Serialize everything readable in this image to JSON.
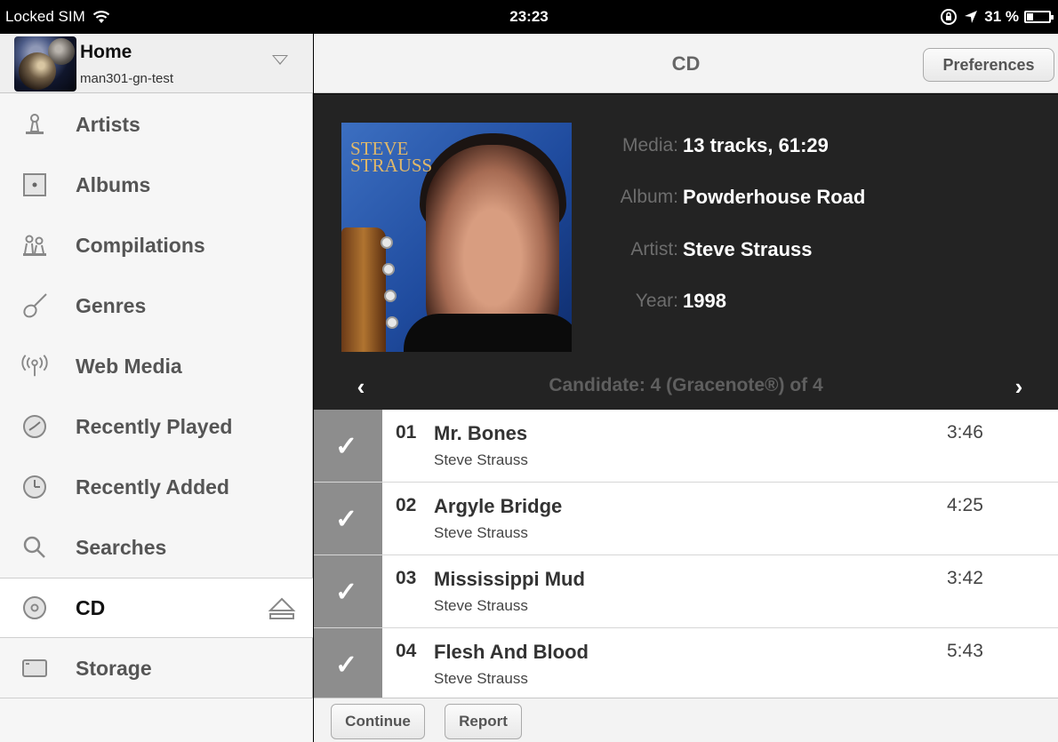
{
  "status_bar": {
    "carrier": "Locked SIM",
    "time": "23:23",
    "battery_percent": "31 %",
    "battery_level": 0.31,
    "icons": [
      "wifi-icon",
      "orientation-lock-icon",
      "location-icon",
      "battery-icon"
    ]
  },
  "sidebar": {
    "header": {
      "title": "Home",
      "subtitle": "man301-gn-test"
    },
    "items": [
      {
        "label": "Artists",
        "icon": "artist-icon"
      },
      {
        "label": "Albums",
        "icon": "album-icon"
      },
      {
        "label": "Compilations",
        "icon": "compilations-icon"
      },
      {
        "label": "Genres",
        "icon": "guitar-icon"
      },
      {
        "label": "Web Media",
        "icon": "antenna-icon"
      },
      {
        "label": "Recently Played",
        "icon": "clock-icon"
      },
      {
        "label": "Recently Added",
        "icon": "clock-icon"
      },
      {
        "label": "Searches",
        "icon": "search-icon"
      },
      {
        "label": "CD",
        "icon": "cd-icon",
        "selected": true
      },
      {
        "label": "Storage",
        "icon": "storage-icon"
      }
    ]
  },
  "topbar": {
    "title": "CD",
    "preferences_label": "Preferences"
  },
  "info": {
    "cover_text_line1": "Steve",
    "cover_text_line2": "Strauss",
    "media_label": "Media:",
    "media_value": "13 tracks, 61:29",
    "album_label": "Album:",
    "album_value": "Powderhouse Road",
    "artist_label": "Artist:",
    "artist_value": "Steve Strauss",
    "year_label": "Year:",
    "year_value": "1998",
    "candidate_text": "Candidate: 4 (Gracenote®) of 4"
  },
  "tracks": [
    {
      "num": "01",
      "title": "Mr. Bones",
      "artist": "Steve Strauss",
      "time": "3:46",
      "checked": true
    },
    {
      "num": "02",
      "title": "Argyle Bridge",
      "artist": "Steve Strauss",
      "time": "4:25",
      "checked": true
    },
    {
      "num": "03",
      "title": "Mississippi Mud",
      "artist": "Steve Strauss",
      "time": "3:42",
      "checked": true
    },
    {
      "num": "04",
      "title": "Flesh And Blood",
      "artist": "Steve Strauss",
      "time": "5:43",
      "checked": true
    }
  ],
  "bottombar": {
    "continue_label": "Continue",
    "report_label": "Report"
  },
  "colors": {
    "dark_panel": "#232323",
    "check_cell": "#8d8d8d",
    "sidebar_bg": "#f6f6f6"
  }
}
